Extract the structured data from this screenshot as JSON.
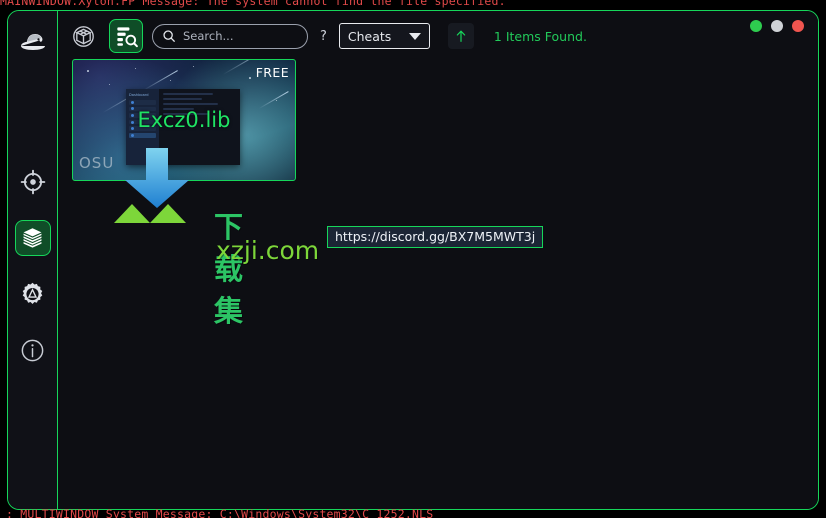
{
  "console": {
    "top_message": "MAINWINDOW.Xylon.FP Message: The system cannot find the file specified.",
    "bottom_message": ": MULTIWINDOW System Message: C:\\Windows\\System32\\C_1252.NLS"
  },
  "sidebar": {
    "items": [
      {
        "name": "logo",
        "icon": "fedora-hat-icon",
        "label": "",
        "selected": false
      },
      {
        "name": "aimbot",
        "icon": "crosshair-target-icon",
        "label": "",
        "selected": false
      },
      {
        "name": "packages",
        "icon": "open-box-icon",
        "label": "",
        "selected": true
      },
      {
        "name": "settings",
        "icon": "gear-icon",
        "label": "",
        "selected": false
      },
      {
        "name": "info",
        "icon": "info-circle-icon",
        "label": "",
        "selected": false
      }
    ]
  },
  "toolbar": {
    "tabs": [
      {
        "name": "store-tab",
        "icon": "closed-box-icon",
        "selected": false
      },
      {
        "name": "library-tab",
        "icon": "list-search-icon",
        "selected": true
      }
    ],
    "search": {
      "placeholder": "Search...",
      "value": ""
    },
    "help_label": "?",
    "category_dropdown": {
      "value": "Cheats",
      "options": [
        "Cheats"
      ]
    },
    "share_icon": "upload-arrow-icon",
    "items_found": "1 Items Found."
  },
  "window_controls": [
    {
      "name": "minimize-button",
      "color": "#2ecc4f"
    },
    {
      "name": "maximize-button",
      "color": "#cfd2d6"
    },
    {
      "name": "close-button",
      "color": "#f0554f"
    }
  ],
  "results": {
    "cards": [
      {
        "title": "Excz0.lib",
        "badge": "FREE",
        "image_label": "OSU",
        "thumb_nav_title": "Dashboard"
      }
    ]
  },
  "watermark": {
    "cn_text": "下载集",
    "domain_text": "xzji.com"
  },
  "tooltip": {
    "text": "https://discord.gg/BX7M5MWT3j"
  },
  "colors": {
    "accent_green": "#16d65a",
    "title_green": "#1fe364",
    "background": "#0d0e13",
    "console_red": "#e24a4a"
  }
}
